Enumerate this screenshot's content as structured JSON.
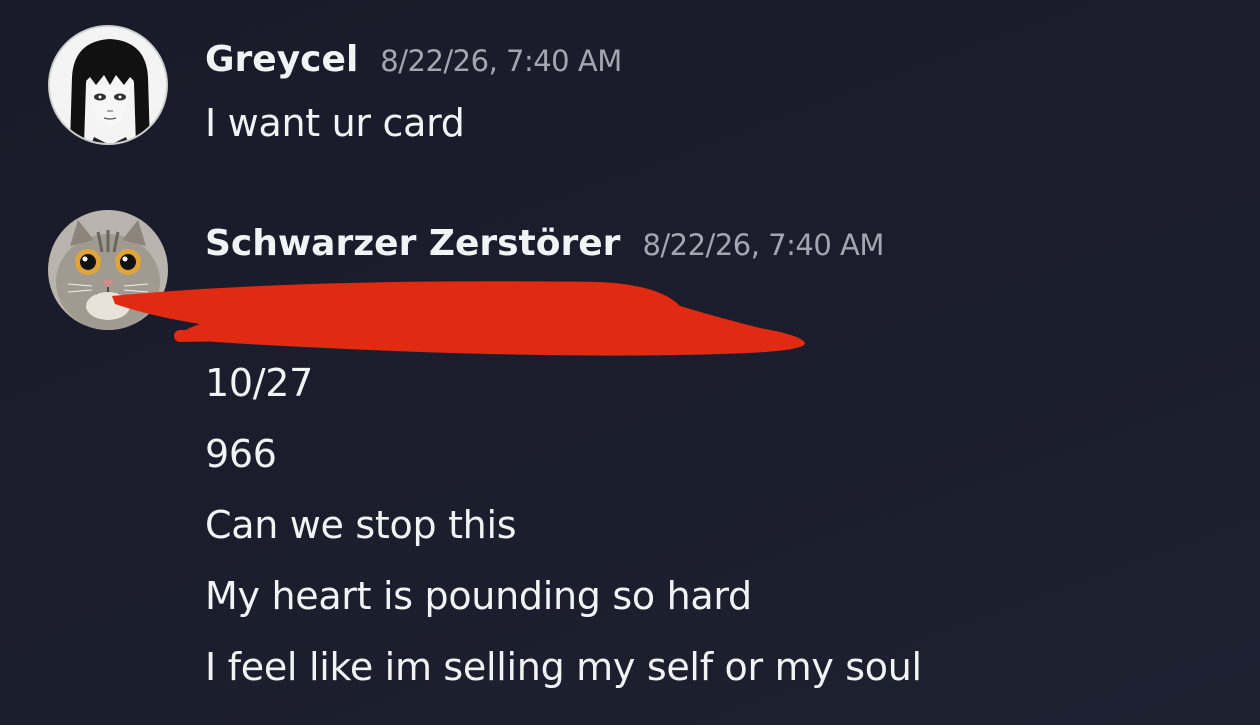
{
  "messages": [
    {
      "author": "Greycel",
      "timestamp": "8/22/26, 7:40 AM",
      "avatar_icon": "manga-girl-avatar-icon",
      "lines": [
        "I want ur card"
      ]
    },
    {
      "author": "Schwarzer Zerstörer",
      "timestamp": "8/22/26, 7:40 AM",
      "avatar_icon": "cat-avatar-icon",
      "lines": [
        "10/27",
        "966",
        "Can we stop this",
        "My heart is pounding so hard",
        "I feel like im selling my self or my soul"
      ]
    }
  ],
  "colors": {
    "background": "#1b1c2b",
    "text": "#f2f3f5",
    "timestamp": "#a3a6ae",
    "redaction": "#e02a12"
  }
}
